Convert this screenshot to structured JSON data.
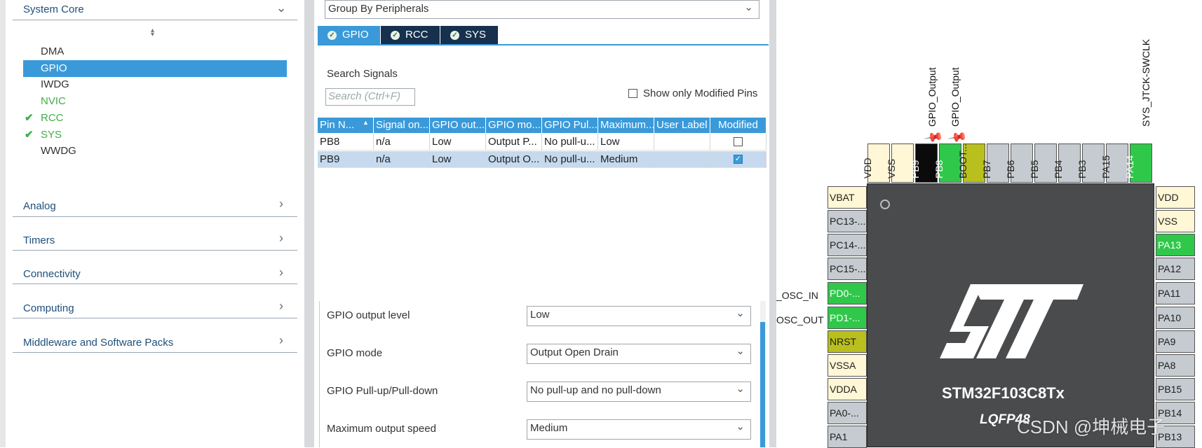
{
  "left_panel": {
    "system_core": {
      "title": "System Core",
      "items": [
        {
          "label": "DMA",
          "status": "none"
        },
        {
          "label": "GPIO",
          "status": "selected"
        },
        {
          "label": "IWDG",
          "status": "none"
        },
        {
          "label": "NVIC",
          "status": "green"
        },
        {
          "label": "RCC",
          "status": "checked"
        },
        {
          "label": "SYS",
          "status": "checked"
        },
        {
          "label": "WWDG",
          "status": "none"
        }
      ]
    },
    "categories": [
      "Analog",
      "Timers",
      "Connectivity",
      "Computing",
      "Middleware and Software Packs"
    ]
  },
  "middle_panel": {
    "group_by": "Group By Peripherals",
    "tabs": [
      "GPIO",
      "RCC",
      "SYS"
    ],
    "search_label": "Search Signals",
    "search_placeholder": "Search (Ctrl+F)",
    "show_modified_label": "Show only Modified Pins",
    "table": {
      "headers": [
        "Pin N...",
        "Signal on...",
        "GPIO out...",
        "GPIO mo...",
        "GPIO Pul...",
        "Maximum...",
        "User Label",
        "Modified"
      ],
      "rows": [
        {
          "pin": "PB8",
          "signal": "n/a",
          "output": "Low",
          "mode": "Output P...",
          "pull": "No pull-u...",
          "speed": "Low",
          "user_label": "",
          "modified": false
        },
        {
          "pin": "PB9",
          "signal": "n/a",
          "output": "Low",
          "mode": "Output O...",
          "pull": "No pull-u...",
          "speed": "Medium",
          "user_label": "",
          "modified": true
        }
      ]
    },
    "config": [
      {
        "label": "GPIO output level",
        "value": "Low"
      },
      {
        "label": "GPIO mode",
        "value": "Output Open Drain"
      },
      {
        "label": "GPIO Pull-up/Pull-down",
        "value": "No pull-up and no pull-down"
      },
      {
        "label": "Maximum output speed",
        "value": "Medium"
      }
    ]
  },
  "chip_view": {
    "top_labels": {
      "pb9": "GPIO_Output",
      "pb8": "GPIO_Output",
      "pa14": "SYS_JTCK-SWCLK"
    },
    "top_pins": [
      "VDD",
      "VSS",
      "PB9",
      "PB8",
      "BOOT...",
      "PB7",
      "PB6",
      "PB5",
      "PB4",
      "PB3",
      "PA15",
      "PA14"
    ],
    "left_pins": [
      "VBAT",
      "PC13-...",
      "PC14-...",
      "PC15-...",
      "PD0-...",
      "PD1-...",
      "NRST",
      "VSSA",
      "VDDA",
      "PA0-...",
      "PA1"
    ],
    "right_pins": [
      "VDD",
      "VSS",
      "PA13",
      "PA12",
      "PA11",
      "PA10",
      "PA9",
      "PA8",
      "PB15",
      "PB14",
      "PB13"
    ],
    "left_signals": [
      "_OSC_IN",
      "OSC_OUT"
    ],
    "chip_name": "STM32F103C8Tx",
    "package": "LQFP48",
    "watermark": "CSDN @坤械电子",
    "colors": {
      "power": "#fff7d6",
      "default": "#c5cbd0",
      "enabled": "#2fc84a",
      "selected": "#0b0b0b",
      "boot": "#b9bf1c"
    }
  }
}
